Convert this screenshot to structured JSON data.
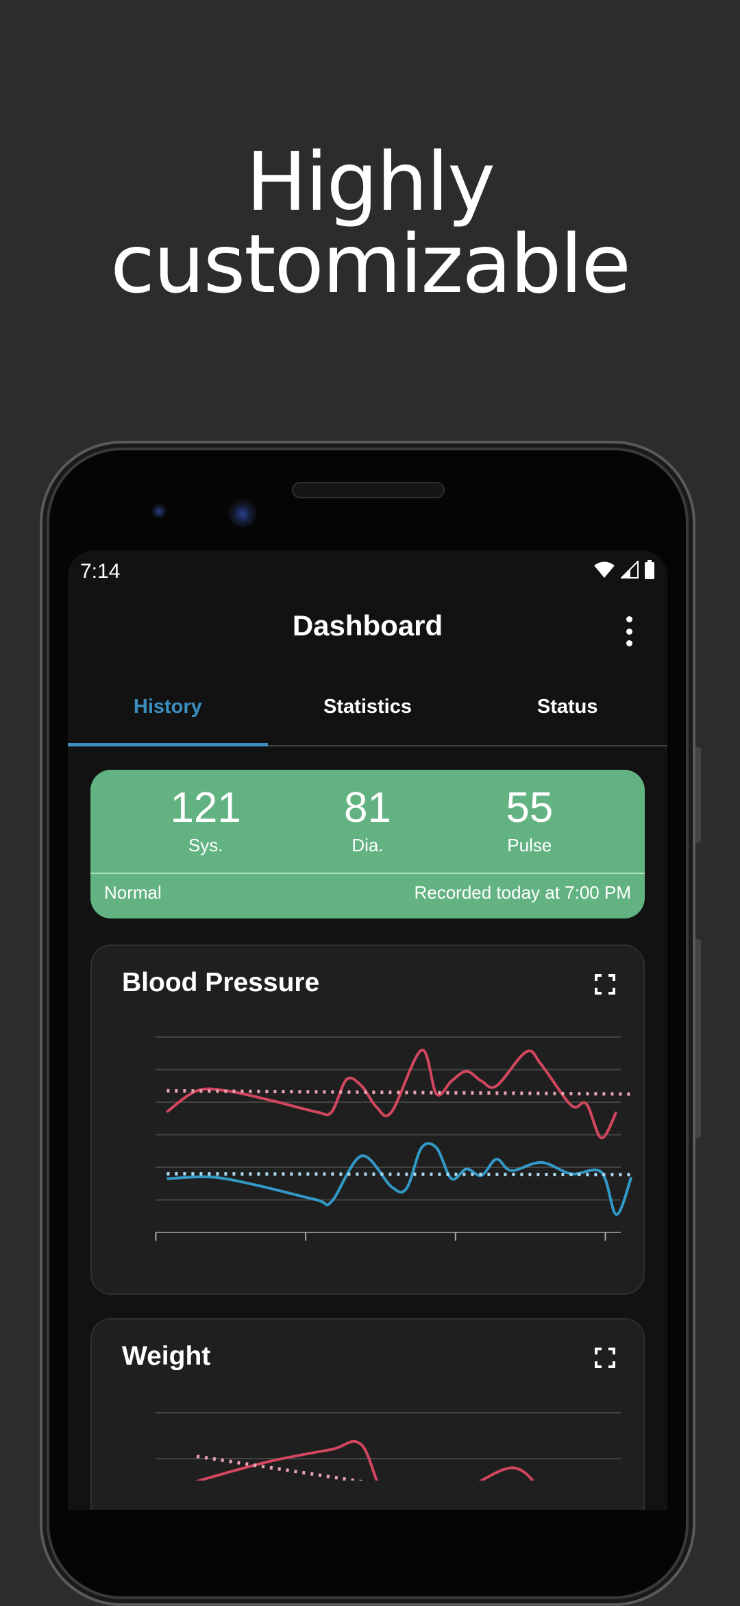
{
  "headline": {
    "line1": "Highly",
    "line2": "customizable"
  },
  "status_bar": {
    "time": "7:14",
    "icons": [
      "wifi-icon",
      "signal-icon",
      "battery-icon"
    ]
  },
  "app_bar": {
    "title": "Dashboard",
    "menu_icon": "more-vert-icon"
  },
  "tabs": [
    {
      "label": "History",
      "active": true
    },
    {
      "label": "Statistics",
      "active": false
    },
    {
      "label": "Status",
      "active": false
    }
  ],
  "latest_reading": {
    "values": [
      {
        "value": "121",
        "label": "Sys."
      },
      {
        "value": "81",
        "label": "Dia."
      },
      {
        "value": "55",
        "label": "Pulse"
      }
    ],
    "category": "Normal",
    "recorded": "Recorded today at 7:00 PM",
    "color": "#63b382"
  },
  "colors": {
    "accent": "#3b8fc0",
    "systolic": "#d2475f",
    "diastolic": "#3399c6",
    "systolic_avg": "#eaa3b0",
    "diastolic_avg": "#a9d9ee"
  },
  "chart_data": [
    {
      "type": "line",
      "title": "Blood Pressure",
      "ylim": [
        47,
        167
      ],
      "yticks": [
        "167",
        "147",
        "127",
        "107",
        "87",
        "67",
        "47"
      ],
      "xticks": [
        "Jul 22",
        "Aug 1",
        "Aug 11",
        "Aug 21"
      ],
      "grid": true,
      "series": [
        {
          "key": "systolic",
          "x": [
            "Jul 22",
            "Jul 24",
            "Jul 26",
            "Jul 29",
            "Aug 1",
            "Aug 2",
            "Aug 3",
            "Aug 4",
            "Aug 5",
            "Aug 6",
            "Aug 8",
            "Aug 9",
            "Aug 10",
            "Aug 11",
            "Aug 12",
            "Aug 13",
            "Aug 15",
            "Aug 16",
            "Aug 18",
            "Aug 19",
            "Aug 20",
            "Aug 21"
          ],
          "y": [
            121,
            134,
            134,
            128,
            121,
            121,
            141,
            137,
            124,
            121,
            159,
            132,
            140,
            146,
            140,
            137,
            158,
            150,
            125,
            126,
            105,
            121
          ]
        },
        {
          "key": "diastolic",
          "x": [
            "Jul 22",
            "Jul 25",
            "Jul 28",
            "Aug 1",
            "Aug 2",
            "Aug 4",
            "Aug 6",
            "Aug 7",
            "Aug 8",
            "Aug 9",
            "Aug 10",
            "Aug 11",
            "Aug 12",
            "Aug 13",
            "Aug 14",
            "Aug 16",
            "Aug 18",
            "Aug 20",
            "Aug 21",
            "Aug 22"
          ],
          "y": [
            80,
            81,
            76,
            67,
            66,
            94,
            75,
            74,
            99,
            99,
            80,
            86,
            82,
            92,
            85,
            90,
            83,
            84,
            58,
            81
          ]
        },
        {
          "key": "systolic_avg",
          "style": "dotted",
          "x": [
            "Jul 22",
            "Aug 22"
          ],
          "y": [
            134,
            132
          ]
        },
        {
          "key": "diastolic_avg",
          "style": "dotted",
          "x": [
            "Jul 22",
            "Aug 22"
          ],
          "y": [
            83,
            82.5
          ]
        }
      ]
    },
    {
      "type": "line",
      "title": "Weight",
      "yticks": [
        "72.5",
        "71.5"
      ],
      "grid": true,
      "series": [
        {
          "key": "systolic",
          "x": [
            "Jul 23",
            "Jul 25",
            "Jul 29",
            "Aug 2",
            "Aug 4",
            "Aug 6",
            "Aug 10",
            "Aug 14",
            "Aug 16"
          ],
          "y": [
            70.9,
            71.1,
            71.45,
            71.7,
            71.8,
            70.5,
            70.7,
            71.3,
            70.8
          ]
        },
        {
          "key": "systolic_avg",
          "style": "dotted",
          "x": [
            "Jul 24",
            "Aug 8"
          ],
          "y": [
            71.55,
            70.8
          ]
        }
      ]
    }
  ]
}
